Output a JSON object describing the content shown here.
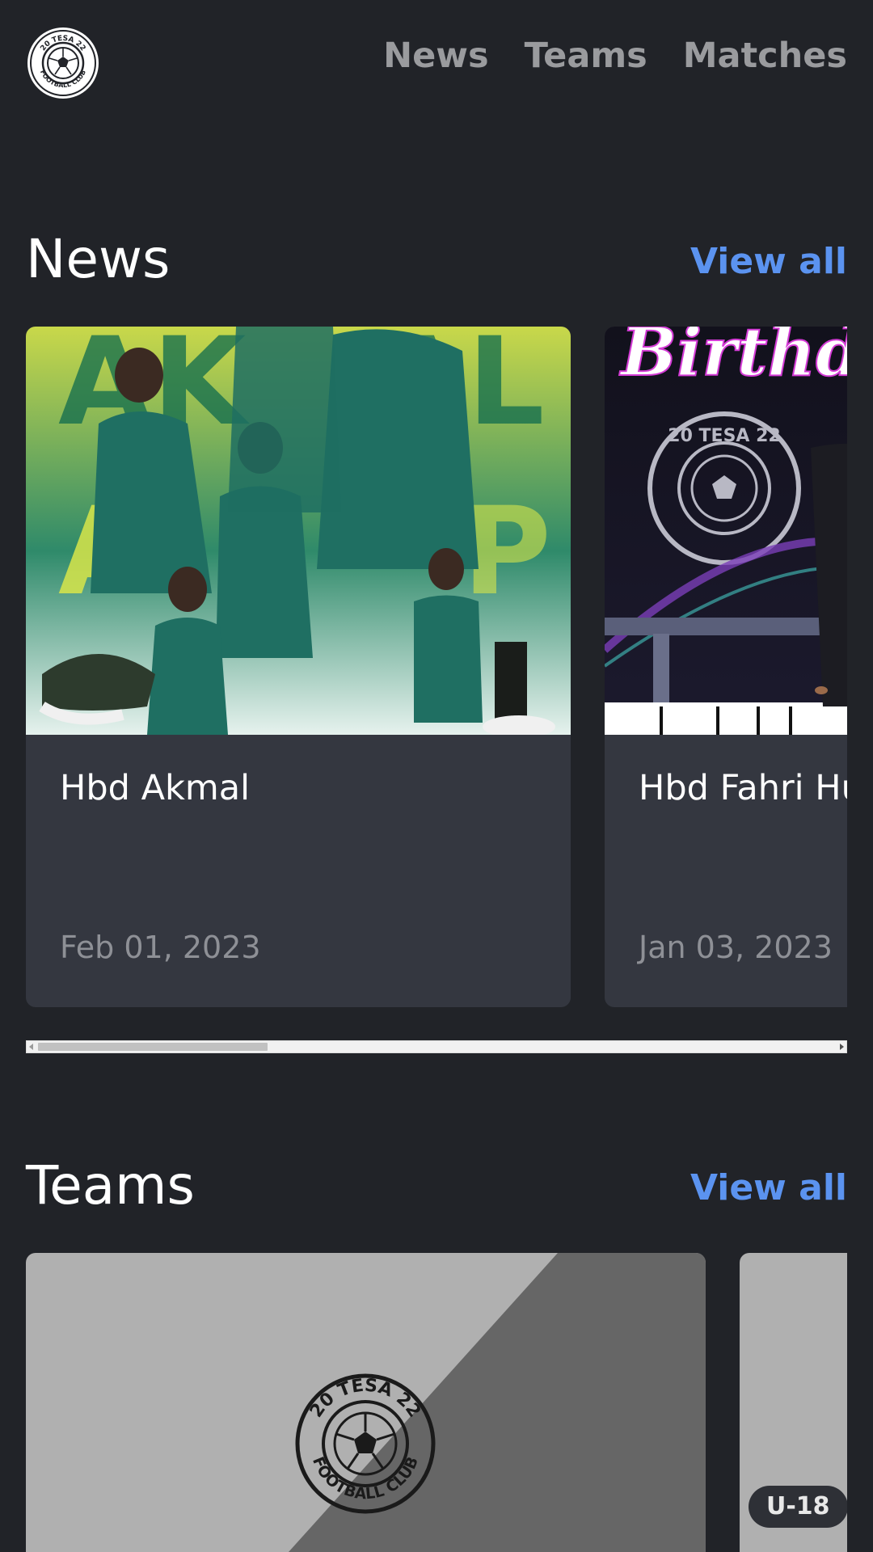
{
  "header": {
    "logo_alt": "20 TESA 22 FOOTBALL CLUB",
    "nav": [
      {
        "label": "News"
      },
      {
        "label": "Teams"
      },
      {
        "label": "Matches"
      }
    ]
  },
  "news": {
    "title": "News",
    "view_all": "View all",
    "cards": [
      {
        "title": "Hbd Akmal",
        "date": "Feb 01, 2023"
      },
      {
        "title": "Hbd Fahri Hu",
        "date": "Jan 03, 2023"
      }
    ]
  },
  "teams": {
    "title": "Teams",
    "view_all": "View all",
    "cards": [
      {
        "badge": ""
      },
      {
        "badge": "U-18"
      }
    ]
  },
  "colors": {
    "background": "#212328",
    "card": "#343740",
    "accent": "#5b93f0",
    "nav_text": "#9a9b9e",
    "date_text": "#8e9096"
  },
  "logo": {
    "text_top": "20 TESA 22",
    "text_bottom": "FOOTBALL CLUB"
  }
}
